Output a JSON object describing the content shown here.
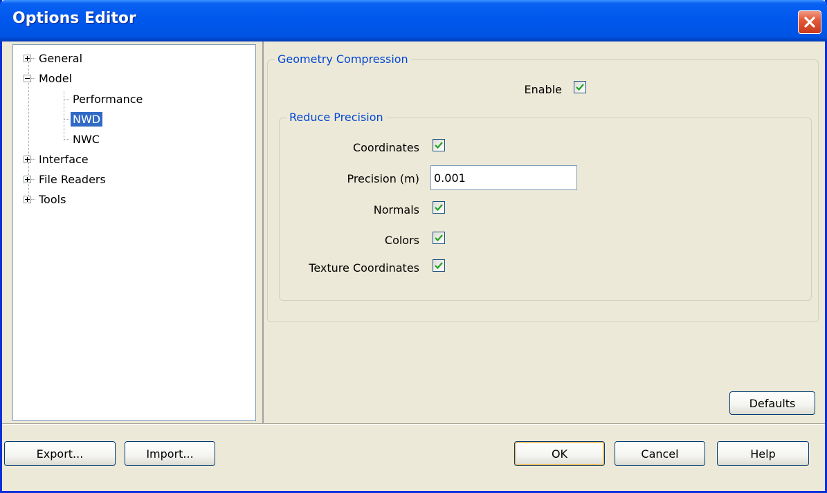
{
  "window": {
    "title": "Options Editor"
  },
  "tree": {
    "items": [
      {
        "label": "General",
        "expander": "+"
      },
      {
        "label": "Model",
        "expander": "-"
      },
      {
        "label": "Performance"
      },
      {
        "label": "NWD",
        "selected": true
      },
      {
        "label": "NWC"
      },
      {
        "label": "Interface",
        "expander": "+"
      },
      {
        "label": "File Readers",
        "expander": "+"
      },
      {
        "label": "Tools",
        "expander": "+"
      }
    ]
  },
  "geometry": {
    "legend": "Geometry Compression",
    "enable_label": "Enable",
    "enable_checked": true,
    "reduce": {
      "legend": "Reduce Precision",
      "coordinates_label": "Coordinates",
      "coordinates_checked": true,
      "precision_label": "Precision (m)",
      "precision_value": "0.001",
      "normals_label": "Normals",
      "normals_checked": true,
      "colors_label": "Colors",
      "colors_checked": true,
      "texture_label": "Texture Coordinates",
      "texture_checked": true
    }
  },
  "buttons": {
    "defaults": "Defaults",
    "export": "Export...",
    "import": "Import...",
    "ok": "OK",
    "cancel": "Cancel",
    "help": "Help"
  },
  "icons": {
    "close": "close-icon",
    "check": "checkmark-icon",
    "expand": "plus-box-icon",
    "collapse": "minus-box-icon"
  },
  "colors": {
    "titlebar": "#0054e3",
    "selection": "#316ac5",
    "legend_text": "#0046d5",
    "checkmark": "#21a121",
    "dialog_bg": "#ece9d8"
  }
}
